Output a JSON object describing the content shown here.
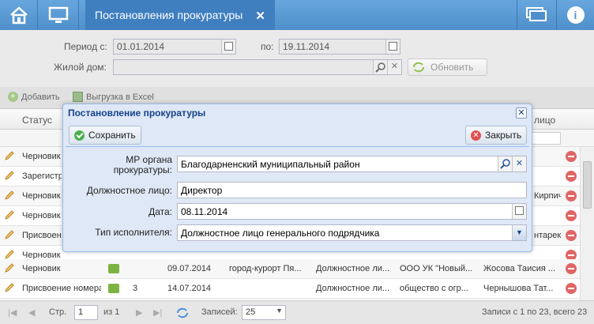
{
  "header": {
    "tab_title": "Постановления прокуратуры",
    "close_glyph": "✕",
    "info_glyph": "i"
  },
  "filter": {
    "period_from_label": "Период с:",
    "period_from_value": "01.01.2014",
    "period_to_label": "по:",
    "period_to_value": "19.11.2014",
    "house_label": "Жилой дом:",
    "house_value": "",
    "refresh_label": "Обновить"
  },
  "toolbar": {
    "add_label": "Добавить",
    "export_label": "Выгрузка в Excel"
  },
  "grid": {
    "header_status": "Статус",
    "header_person": "лицо",
    "rows": [
      {
        "status": "Черновик",
        "num": "",
        "date": "",
        "city": "",
        "post": "",
        "org": "",
        "person": ""
      },
      {
        "status": "Зарегистр",
        "num": "",
        "date": "",
        "city": "",
        "post": "",
        "org": "",
        "person": ""
      },
      {
        "status": "Черновик",
        "num": "",
        "date": "",
        "city": "",
        "post": "",
        "org": "",
        "person": "Кирпичев Тат..."
      },
      {
        "status": "Черновик",
        "num": "",
        "date": "",
        "city": "",
        "post": "",
        "org": "",
        "person": ""
      },
      {
        "status": "Присвоен",
        "num": "",
        "date": "",
        "city": "",
        "post": "",
        "org": "",
        "person": "нтарек А..."
      },
      {
        "status": "Черновик",
        "num": "",
        "date": "",
        "city": "",
        "post": "",
        "org": "",
        "person": ""
      },
      {
        "status": "Черновик",
        "num": "",
        "date": "09.07.2014",
        "city": "город-курорт Пя...",
        "post": "Должностное ли...",
        "org": "ООО УК \"Новый...",
        "person": "Жосова Таисия ..."
      },
      {
        "status": "Присвоение номера",
        "num": "3",
        "date": "14.07.2014",
        "city": "",
        "post": "Должностное ли...",
        "org": "общество с огр...",
        "person": "Чернышова Тат..."
      }
    ]
  },
  "pager": {
    "page_label": "Стр.",
    "page_value": "1",
    "of_label": "из 1",
    "records_label": "Записей:",
    "records_value": "25",
    "summary": "Записи с 1 по 23, всего 23"
  },
  "modal": {
    "title": "Постановление прокуратуры",
    "close_glyph": "✕",
    "save_label": "Сохранить",
    "close_label": "Закрыть",
    "mr_label_line1": "МР органа",
    "mr_label_line2": "прокуратуры:",
    "mr_value": "Благодарненский муниципальный район",
    "official_label": "Должностное лицо:",
    "official_value": "Директор",
    "date_label": "Дата:",
    "date_value": "08.11.2014",
    "executor_label": "Тип исполнителя:",
    "executor_value": "Должностное лицо генерального подрядчика"
  },
  "colors": {
    "topbar": "#4f8fcb",
    "active_tab": "#3f7fc0",
    "modal_bg": "#dfe8f6",
    "modal_title": "#15428b"
  }
}
